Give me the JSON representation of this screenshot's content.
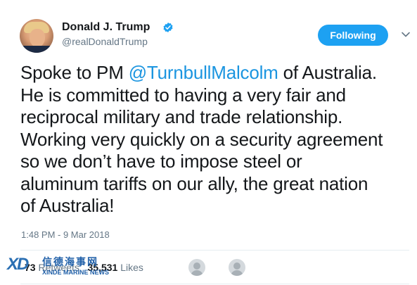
{
  "author": {
    "display_name": "Donald J. Trump",
    "username": "@realDonaldTrump",
    "verified": true
  },
  "actions": {
    "follow_label": "Following"
  },
  "tweet": {
    "lines": [
      {
        "before": "Spoke to PM ",
        "mention": "@TurnbullMalcolm",
        "after": " of Australia."
      },
      {
        "text": "He is committed to having a very fair and"
      },
      {
        "text": "reciprocal military and trade relationship."
      },
      {
        "text": "Working very quickly on a security agreement"
      },
      {
        "text": "so we don’t have to impose steel or"
      },
      {
        "text": "aluminum tariffs on our ally, the great nation"
      },
      {
        "text": "of Australia!"
      }
    ],
    "timestamp": "1:48 PM - 9 Mar 2018"
  },
  "stats": {
    "retweets_value": "73",
    "retweets_label": "Retweets",
    "likes_value": "35,531",
    "likes_label": "Likes"
  },
  "watermark": {
    "mark": "XD",
    "chinese": "信德海事网",
    "english": "XINDE MARINE NEWS"
  },
  "colors": {
    "accent": "#1da1f2",
    "mention": "#1b95e0",
    "secondary_text": "#657786"
  },
  "icons": [
    "verified-badge-icon",
    "chevron-down-icon"
  ]
}
